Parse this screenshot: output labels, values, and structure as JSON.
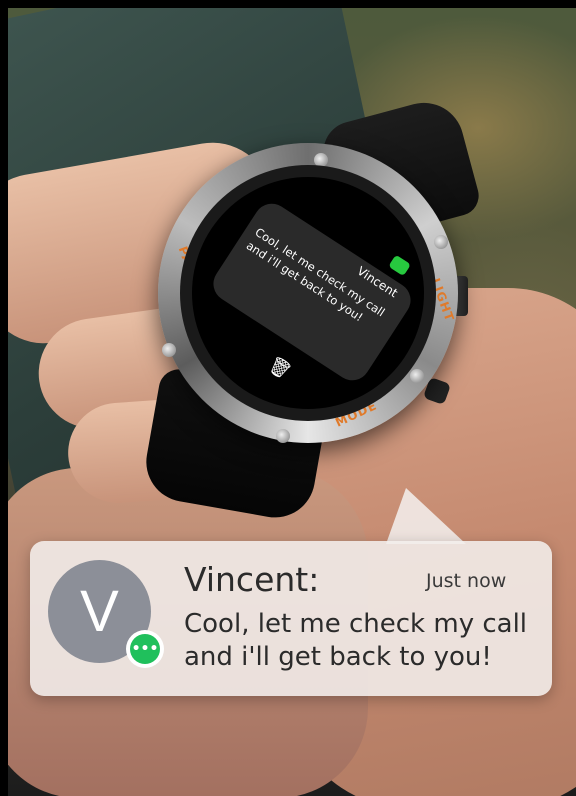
{
  "watch": {
    "sender": "Vincent",
    "message": "Cool, let me check my call and i'll get back to you!",
    "bezel_labels": {
      "left": "PAGER",
      "right": "LIGHT",
      "bottom": "MODE"
    }
  },
  "notification": {
    "avatar_letter": "V",
    "sender": "Vincent:",
    "time": "Just now",
    "message": "Cool, let me check my call and i'll get back to you!"
  },
  "icons": {
    "watch_app": "message-app-icon",
    "trash": "trash-icon",
    "badge": "chat-bubble-icon"
  },
  "colors": {
    "bezel_accent": "#e07a2a",
    "badge_green": "#20c05c",
    "avatar_gray": "#8c8f98"
  }
}
